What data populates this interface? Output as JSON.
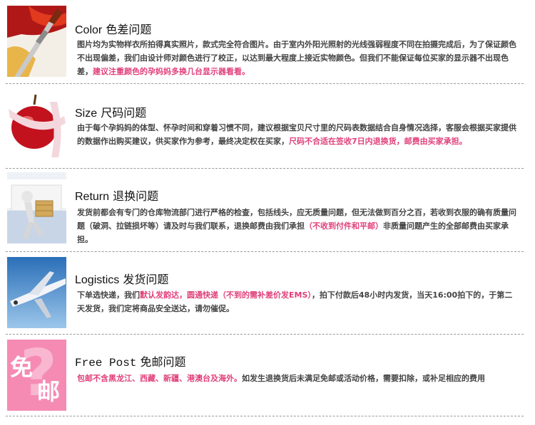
{
  "sections": [
    {
      "title_en": "Color",
      "title_cn": "色差问题",
      "icon": "paintbrush-icon",
      "text": "图片均为实物样衣所拍得真实照片，款式完全符合图片。由于室内外阳光照射的光线强弱程度不同在拍摄完成后，为了保证颜色不出现偏差，我们由设计师对颜色进行了校正，以达到最大程度上接近实物颜色。但我们不能保证每位买家的显示器不出现色差，",
      "highlight": "建议注重颜色的孕妈妈多换几台显示器看看。"
    },
    {
      "title_en": "Size",
      "title_cn": "尺码问题",
      "icon": "apple-measuring-tape-icon",
      "text": "由于每个孕妈妈的体型、怀孕时间和穿着习惯不同，建议根据宝贝尺寸里的尺码表数据结合自身情况选择，客服会根据买家提供的数据作出购买建议，供买家作为参考，最终决定权在买家，",
      "highlight": "尺码不合适在签收7日内退换货，邮费由买家承担。"
    },
    {
      "title_en": "Return",
      "title_cn": "退换问题",
      "icon": "person-carrying-box-icon",
      "text_before": "发货前都会有专门的仓库物流部门进行严格的检查，包括线头，应无质量问题，但无法做到百分之百，若收到衣服的确有质量问题（破洞、拉链损坏等）请及时与我们联系，退换邮费由我们承担",
      "highlight": "（不收到付件和平邮）",
      "text_after": "非质量问题产生的全部邮费由买家承担。"
    },
    {
      "title_en": "Logistics",
      "title_cn": "发货问题",
      "icon": "airplane-icon",
      "text_before": "下单选快递，我们",
      "highlight": "默认发韵达，圆通快递（不到的需补差价发EMS）",
      "text_after": "，拍下付款后48小时内发货，当天16:00拍下的，于第二天发货，我们定将商品安全送达，请勿催促。"
    },
    {
      "title_en": "Free Post",
      "title_cn": "免邮问题",
      "icon": "free-post-badge-icon",
      "badge_top": "免",
      "badge_bottom": "邮",
      "highlight": "包邮不含黑龙江、西藏、新疆、港澳台及海外。",
      "text_after": "如发生退换货后未满足免邮或活动价格，需要扣除，或补足相应的费用"
    }
  ],
  "colors": {
    "highlight": "#e0407a",
    "separator": "#9a9a9a"
  }
}
